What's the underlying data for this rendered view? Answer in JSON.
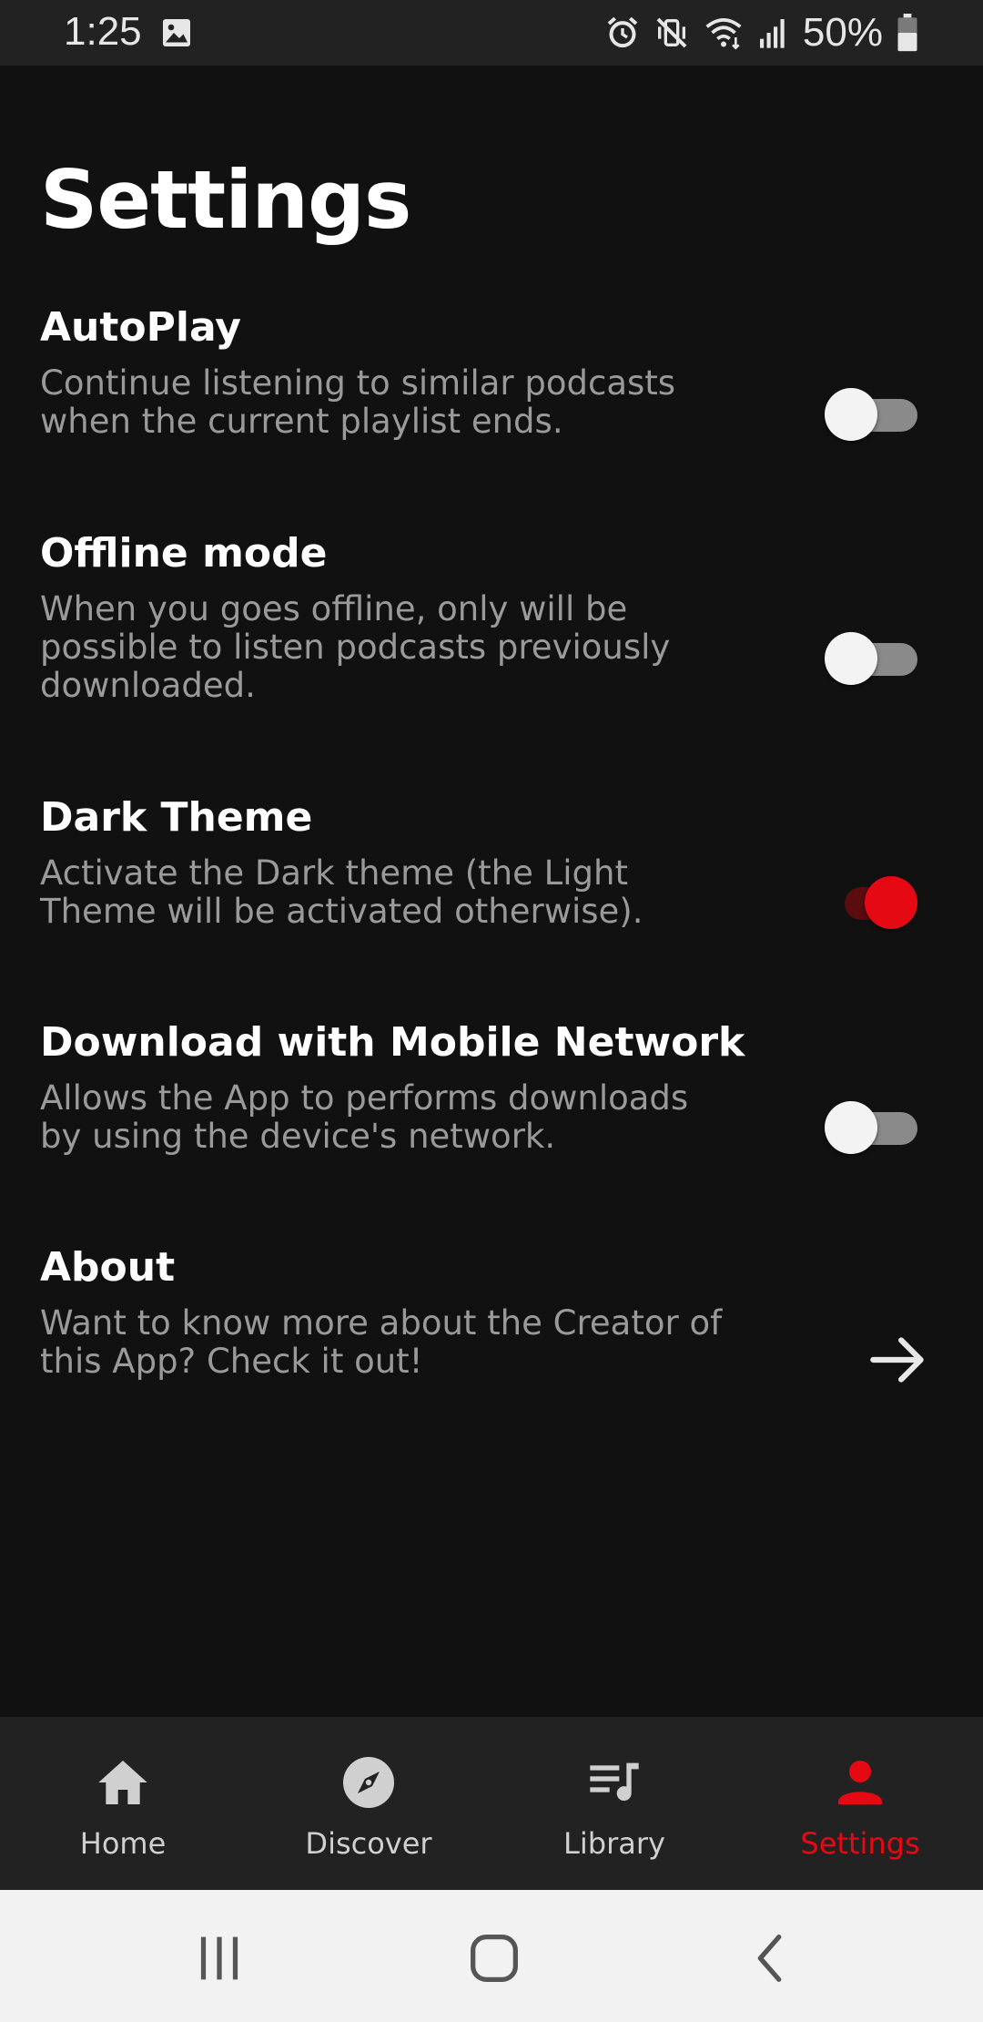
{
  "status_bar": {
    "time": "1:25",
    "battery": "50%"
  },
  "page": {
    "title": "Settings"
  },
  "settings": [
    {
      "title": "AutoPlay",
      "description": "Continue listening to similar podcasts when the current playlist ends.",
      "control": "toggle",
      "enabled": false
    },
    {
      "title": "Offline mode",
      "description": "When you goes offline, only will be possible to listen podcasts previously downloaded.",
      "control": "toggle",
      "enabled": false
    },
    {
      "title": "Dark Theme",
      "description": "Activate the Dark theme (the Light Theme will be activated otherwise).",
      "control": "toggle",
      "enabled": true
    },
    {
      "title": "Download with Mobile Network",
      "description": "Allows the App to performs downloads by using the device's network.",
      "control": "toggle",
      "enabled": false
    },
    {
      "title": "About",
      "description": "Want to know more about the Creator of this App? Check it out!",
      "control": "arrow-right-icon"
    }
  ],
  "bottom_nav": {
    "items": [
      {
        "label": "Home",
        "icon": "home-icon",
        "active": false
      },
      {
        "label": "Discover",
        "icon": "compass-icon",
        "active": false
      },
      {
        "label": "Library",
        "icon": "library-icon",
        "active": false
      },
      {
        "label": "Settings",
        "icon": "person-icon",
        "active": true
      }
    ]
  },
  "colors": {
    "background": "#111111",
    "bar_background": "#222222",
    "accent": "#e50914",
    "text_primary": "#ffffff",
    "text_secondary": "#9a9a9a"
  }
}
